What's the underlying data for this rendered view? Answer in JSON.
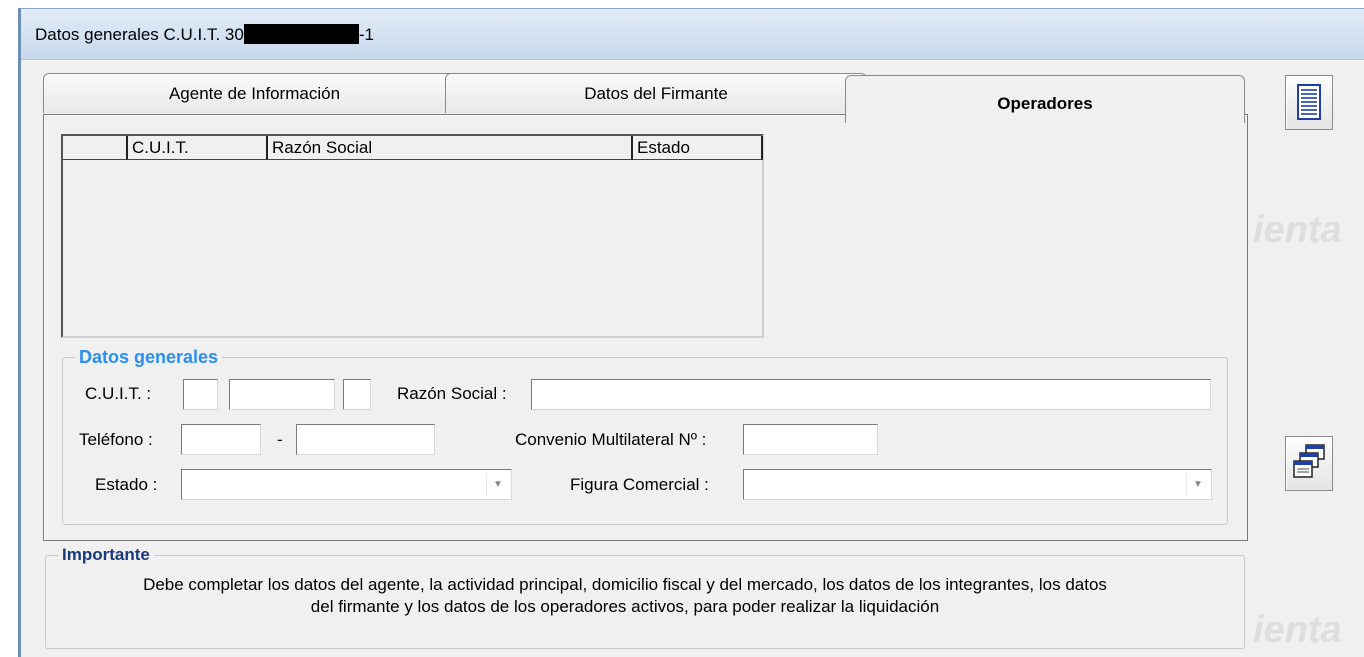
{
  "window": {
    "title_prefix": "Datos generales C.U.I.T. 30",
    "title_suffix": "-1"
  },
  "tabs": [
    {
      "label": "Agente de Información",
      "active": false
    },
    {
      "label": "Datos del Firmante",
      "active": false
    },
    {
      "label": "Operadores",
      "active": true
    }
  ],
  "grid": {
    "columns": [
      "",
      "C.U.I.T.",
      "Razón Social",
      "Estado"
    ],
    "rows": []
  },
  "datos_generales": {
    "legend": "Datos generales",
    "cuit_label": "C.U.I.T. :",
    "razon_social_label": "Razón Social :",
    "telefono_label": "Teléfono :",
    "telefono_sep": "-",
    "convenio_label": "Convenio Multilateral Nº :",
    "estado_label": "Estado :",
    "figura_label": "Figura Comercial :",
    "cuit_part1": "",
    "cuit_part2": "",
    "cuit_part3": "",
    "razon_social": "",
    "telefono_area": "",
    "telefono_numero": "",
    "convenio": "",
    "estado": "",
    "figura_comercial": ""
  },
  "importante": {
    "legend": "Importante",
    "line1": "Debe completar los datos del agente, la actividad principal, domicilio fiscal y del mercado, los datos de los integrantes, los datos",
    "line2": "del firmante y los datos de los operadores activos, para poder realizar la liquidación"
  },
  "side_buttons": [
    {
      "icon": "document-list-icon"
    },
    {
      "icon": "windows-stack-icon"
    }
  ],
  "watermark": [
    "ienta",
    "ienta"
  ],
  "colors": {
    "accent_legend": "#2a8ff0",
    "title_bar": "#d2e0f0",
    "panel": "#f0f0f0"
  }
}
